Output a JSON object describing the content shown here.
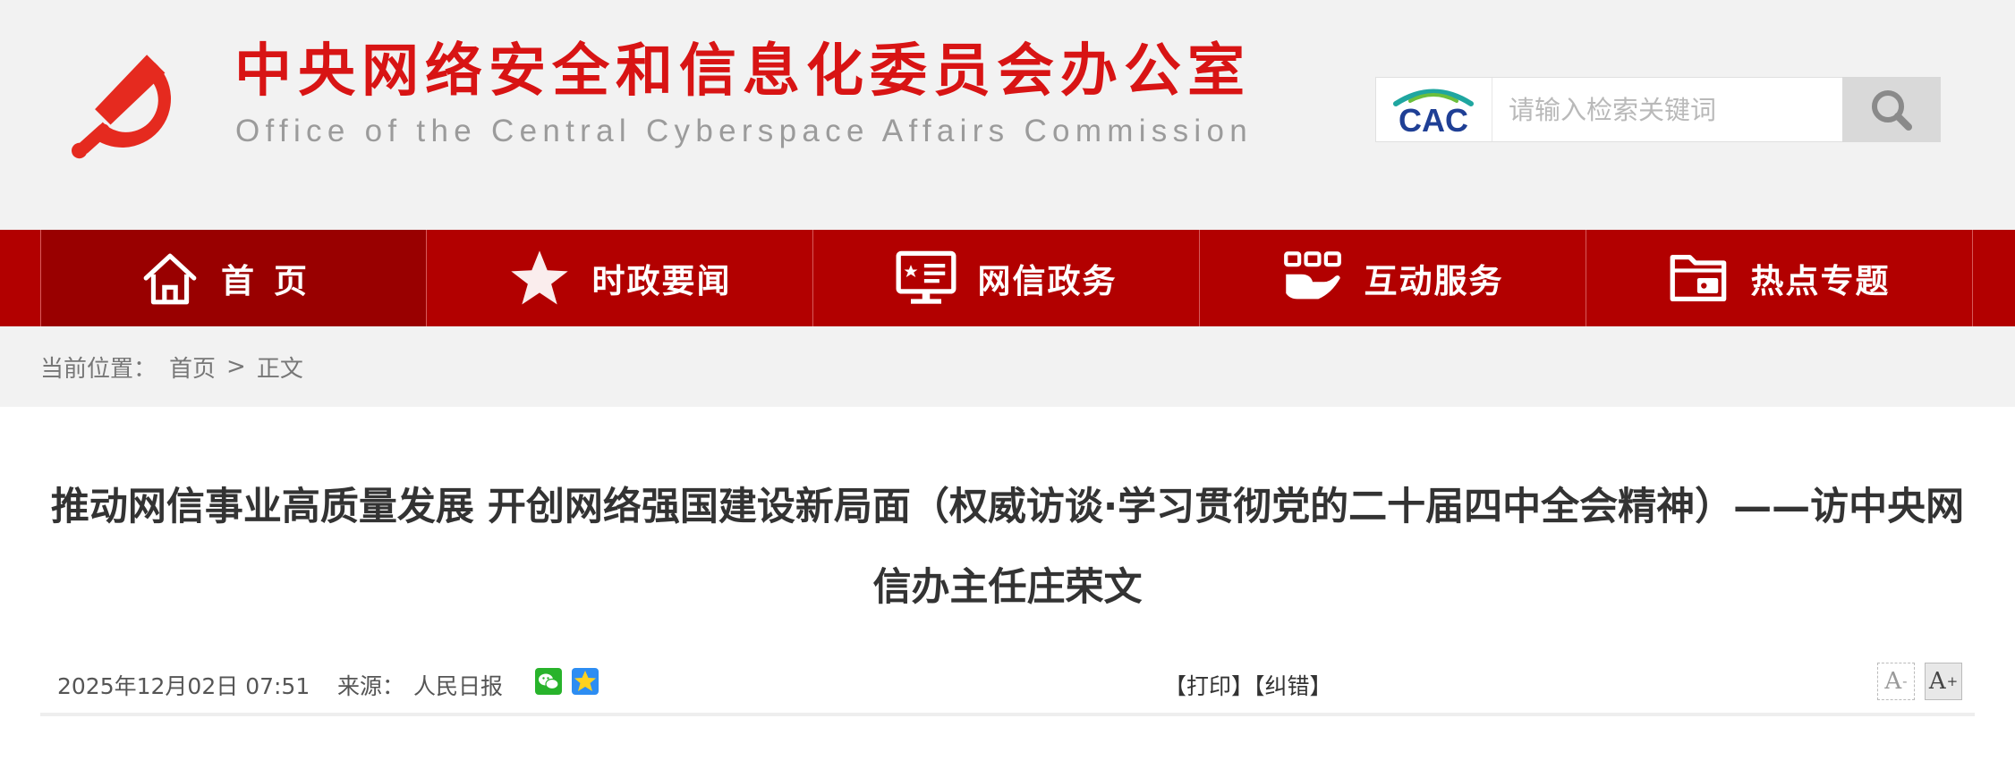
{
  "header": {
    "title_cn": "中央网络安全和信息化委员会办公室",
    "title_en": "Office of the Central Cyberspace Affairs Commission",
    "logo_text": "CAC",
    "search_placeholder": "请输入检索关键词"
  },
  "nav": {
    "items": [
      {
        "label": "首页",
        "icon": "home-icon"
      },
      {
        "label": "时政要闻",
        "icon": "star-icon"
      },
      {
        "label": "网信政务",
        "icon": "monitor-icon"
      },
      {
        "label": "互动服务",
        "icon": "hand-service-icon"
      },
      {
        "label": "热点专题",
        "icon": "folder-icon"
      }
    ]
  },
  "breadcrumb": {
    "label": "当前位置：",
    "home": "首页",
    "separator": ">",
    "current": "正文"
  },
  "article": {
    "title": "推动网信事业高质量发展 开创网络强国建设新局面（权威访谈·学习贯彻党的二十届四中全会精神）——访中央网信办主任庄荣文",
    "date": "2025年12月02日 07:51",
    "source_label": "来源：",
    "source": "人民日报",
    "actions": "【打印】【纠错】",
    "font_smaller": "A",
    "font_smaller_sign": "-",
    "font_larger": "A",
    "font_larger_sign": "+"
  },
  "colors": {
    "brand_red": "#d81414",
    "nav_red": "#b20000",
    "nav_active": "#990000"
  }
}
